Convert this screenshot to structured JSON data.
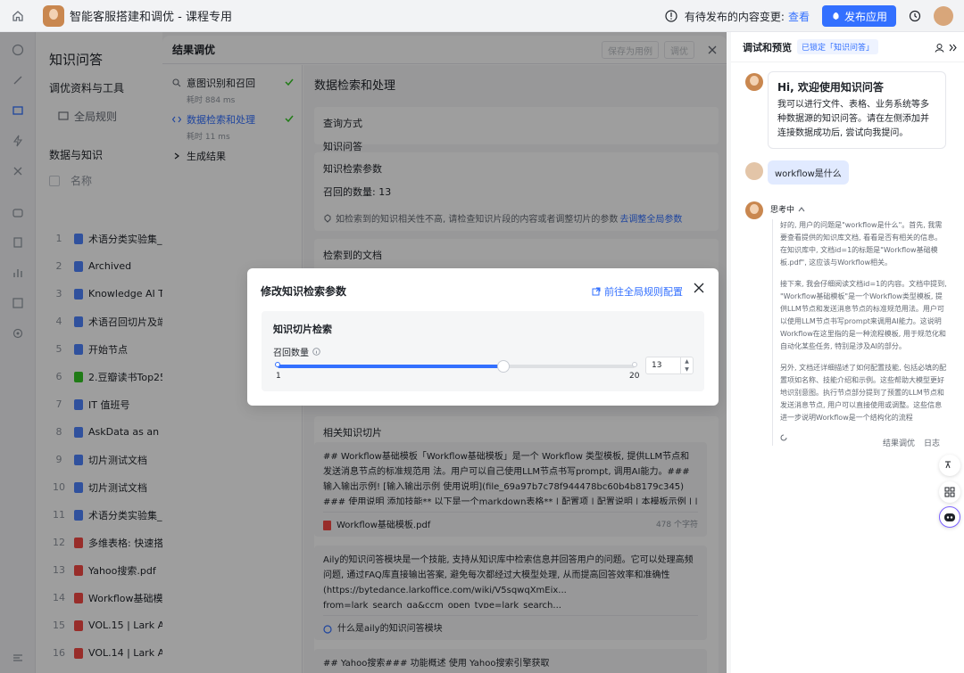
{
  "app": {
    "title": "智能客服搭建和调优 - 课程专用",
    "pending_text": "有待发布的内容变更:",
    "pending_link": "查看",
    "publish_label": "发布应用"
  },
  "knowledge": {
    "heading": "知识问答",
    "section_tools": "调优资料与工具",
    "global_rules": "全局规则",
    "section_data": "数据与知识",
    "col_name": "名称",
    "files": [
      {
        "num": "1",
        "name": "术语分类实验集_术",
        "color": "#4e83fd"
      },
      {
        "num": "2",
        "name": "Archived",
        "color": "#4e83fd"
      },
      {
        "num": "3",
        "name": "Knowledge AI Tea",
        "color": "#4e83fd"
      },
      {
        "num": "4",
        "name": "术语召回切片及端",
        "color": "#4e83fd"
      },
      {
        "num": "5",
        "name": "开始节点",
        "color": "#4e83fd"
      },
      {
        "num": "6",
        "name": "2.豆瓣读书Top250",
        "color": "#34c724"
      },
      {
        "num": "7",
        "name": "IT 值班号",
        "color": "#4e83fd"
      },
      {
        "num": "8",
        "name": "AskData as an Info",
        "color": "#4e83fd"
      },
      {
        "num": "9",
        "name": "切片测试文档",
        "color": "#4e83fd"
      },
      {
        "num": "10",
        "name": "切片测试文档",
        "color": "#4e83fd"
      },
      {
        "num": "11",
        "name": "术语分类实验集_术",
        "color": "#4e83fd"
      },
      {
        "num": "12",
        "name": "多维表格: 快速搭",
        "color": "#f54a45"
      },
      {
        "num": "13",
        "name": "Yahoo搜索.pdf",
        "color": "#f54a45"
      },
      {
        "num": "14",
        "name": "Workflow基础模板",
        "color": "#f54a45"
      },
      {
        "num": "15",
        "name": "VOL.15 | Lark Aily",
        "color": "#f54a45"
      },
      {
        "num": "16",
        "name": "VOL.14 | Lark Aily",
        "color": "#f54a45"
      }
    ]
  },
  "results": {
    "title": "结果调优",
    "save_example": "保存为用例",
    "optimize": "调优",
    "steps": [
      {
        "title": "意图识别和召回",
        "time": "耗时 884 ms"
      },
      {
        "title": "数据检索和处理",
        "time": "耗时 11 ms"
      },
      {
        "title": "生成结果",
        "time": ""
      }
    ],
    "section_title": "数据检索和处理",
    "query_label": "查询方式",
    "query_value": "知识问答",
    "params_label": "知识检索参数",
    "recall_count_text": "召回的数量: 13",
    "hint_text": "如检索到的知识相关性不高, 请检查知识片段的内容或者调整切片的参数",
    "hint_link": "去调整全局参数",
    "retrieved_label": "检索到的文档",
    "related_label": "相关知识切片",
    "snippets": [
      {
        "text": "## Workflow基础模板「Workflow基础模板」是一个 Workflow 类型模板, 提供LLM节点和发送消息节点的标准规范用 法。用户可以自己使用LLM节点书写prompt, 调用AI能力。### 输入输出示例! [输入输出示例 使用说明](file_69a97b7c78f944478bc60b4b8179c345) ### 使用说明 添加技能** 以下是一个markdown表格** | 配置项 | 配置说明 | 本模板示例 | | --- | --- | --- | | 名称 | 必填。在调...",
        "file": "Workflow基础模板.pdf",
        "chars": "478 个字符"
      },
      {
        "text": "Aily的知识问答模块是一个技能, 支持从知识库中检索信息并回答用户的问题。它可以处理高频问题, 通过FAQ库直接输出答案, 避免每次都经过大模型处理, 从而提高回答效率和准确性 (https://bytedance.larkoffice.com/wiki/V5sqwqXmEix... from=lark_search_qa&ccm_open_type=lark_search...",
        "file": "什么是aily的知识问答模块",
        "chars": ""
      },
      {
        "text": "## Yahoo搜索### 功能概述 使用 Yahoo搜索引擎获取",
        "file": "",
        "chars": ""
      }
    ]
  },
  "debug": {
    "title": "调试和预览",
    "tag": "已锁定「知识问答」",
    "greet_title": "Hi, 欢迎使用知识问答",
    "greet_body": "我可以进行文件、表格、业务系统等多种数据源的知识问答。请在左侧添加并连接数据成功后, 尝试向我提问。",
    "user_msg": "workflow是什么",
    "thinking": "思考中",
    "think_p1": "好的, 用户的问题是\"workflow是什么\"。首先, 我需要查看提供的知识库文档, 看看是否有相关的信息。在知识库中, 文档id=1的标题是\"Workflow基础模板.pdf\", 这应该与Workflow相关。",
    "think_p2": "接下来, 我会仔细阅读文档id=1的内容。文档中提到, \"Workflow基础模板\"是一个Workflow类型模板, 提供LLM节点和发送消息节点的标准规范用法。用户可以使用LLM节点书写prompt来调用AI能力。这说明Workflow在这里指的是一种流程模板, 用于规范化和自动化某些任务, 特别是涉及AI的部分。",
    "think_p3": "另外, 文档还详细描述了如何配置技能, 包括必填的配置项如名称、技能介绍和示例。这些帮助大模型更好地识别意图。执行节点部分提到了预置的LLM节点和发送消息节点, 用户可以直接使用或调整。这些信息进一步说明Workflow是一个结构化的流程",
    "foot_tune": "结果调优",
    "foot_log": "日志"
  },
  "modal": {
    "title": "修改知识检索参数",
    "link": "前往全局规则配置",
    "section": "知识切片检索",
    "label": "召回数量",
    "min": "1",
    "max": "20",
    "value": "13",
    "value_num": 13,
    "min_num": 1,
    "max_num": 20
  }
}
